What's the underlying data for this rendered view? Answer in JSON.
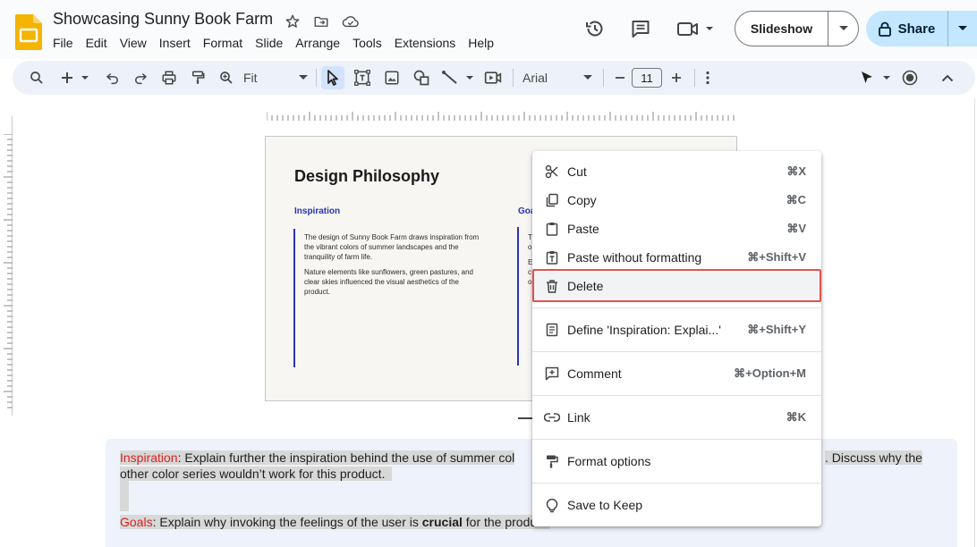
{
  "header": {
    "title": "Showcasing Sunny Book Farm",
    "menu": [
      "File",
      "Edit",
      "View",
      "Insert",
      "Format",
      "Slide",
      "Arrange",
      "Tools",
      "Extensions",
      "Help"
    ],
    "slideshow_label": "Slideshow",
    "share_label": "Share"
  },
  "toolbar": {
    "zoom_value": "Fit",
    "font_name": "Arial",
    "font_size": "11"
  },
  "slide": {
    "title": "Design Philosophy",
    "col1_heading": "Inspiration",
    "col1_para1": "The design of Sunny Book Farm draws inspiration from the vibrant colors of summer landscapes and the tranquility of farm life.",
    "col1_para2": "Nature elements like sunflowers, green pastures, and clear skies influenced the visual aesthetics of the product.",
    "col2_heading_visible": "Goa",
    "col2_line1_visible": "T",
    "col2_line2_visible": "o",
    "col2_line3_visible": "E",
    "col2_line4_visible": "c",
    "col2_line5_visible": "o"
  },
  "notes": {
    "line1_label": "Inspiration",
    "line1_text": ": Explain further the inspiration behind the use of summer col",
    "line1_tail": ". Discuss why the",
    "line2_text": "other color series wouldn’t work for this product.",
    "line3_label": "Goals",
    "line3_text_a": ": Explain why invoking the feelings of the user is ",
    "line3_bold": "crucial",
    "line3_text_b": " for the product."
  },
  "context_menu": {
    "items": [
      {
        "label": "Cut",
        "shortcut": "⌘X",
        "icon": "scissors-icon"
      },
      {
        "label": "Copy",
        "shortcut": "⌘C",
        "icon": "copy-icon"
      },
      {
        "label": "Paste",
        "shortcut": "⌘V",
        "icon": "clipboard-icon"
      },
      {
        "label": "Paste without formatting",
        "shortcut": "⌘+Shift+V",
        "icon": "clipboard-plain-icon"
      },
      {
        "label": "Delete",
        "shortcut": "",
        "icon": "trash-icon"
      },
      {
        "label": "Define 'Inspiration: Explai...'",
        "shortcut": "⌘+Shift+Y",
        "icon": "book-icon"
      },
      {
        "label": "Comment",
        "shortcut": "⌘+Option+M",
        "icon": "comment-add-icon"
      },
      {
        "label": "Link",
        "shortcut": "⌘K",
        "icon": "link-icon"
      },
      {
        "label": "Format options",
        "shortcut": "",
        "icon": "paint-roller-icon"
      },
      {
        "label": "Save to Keep",
        "shortcut": "",
        "icon": "lightbulb-icon"
      }
    ]
  },
  "colors": {
    "accent_blue": "#2a33b8",
    "note_label_red": "#e0201e",
    "highlight_border": "#e2514b",
    "share_bg": "#c2e7ff"
  }
}
